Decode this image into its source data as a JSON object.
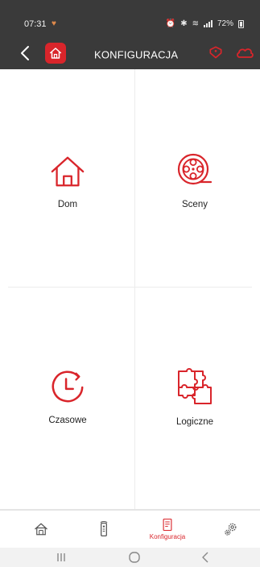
{
  "status_bar": {
    "time": "07:31",
    "battery": "72%"
  },
  "header": {
    "title": "KONFIGURACJA"
  },
  "tiles": [
    {
      "label": "Dom",
      "icon": "house-icon"
    },
    {
      "label": "Sceny",
      "icon": "film-reel-icon"
    },
    {
      "label": "Czasowe",
      "icon": "clock-icon"
    },
    {
      "label": "Logiczne",
      "icon": "puzzle-icon"
    }
  ],
  "bottom_nav": {
    "items": [
      {
        "icon": "home-icon",
        "label": ""
      },
      {
        "icon": "remote-icon",
        "label": ""
      },
      {
        "icon": "document-icon",
        "label": "Konfiguracja"
      },
      {
        "icon": "gears-icon",
        "label": ""
      }
    ]
  },
  "colors": {
    "accent": "#d9252b",
    "header_bg": "#3a3a3a",
    "divider": "#ececec"
  }
}
